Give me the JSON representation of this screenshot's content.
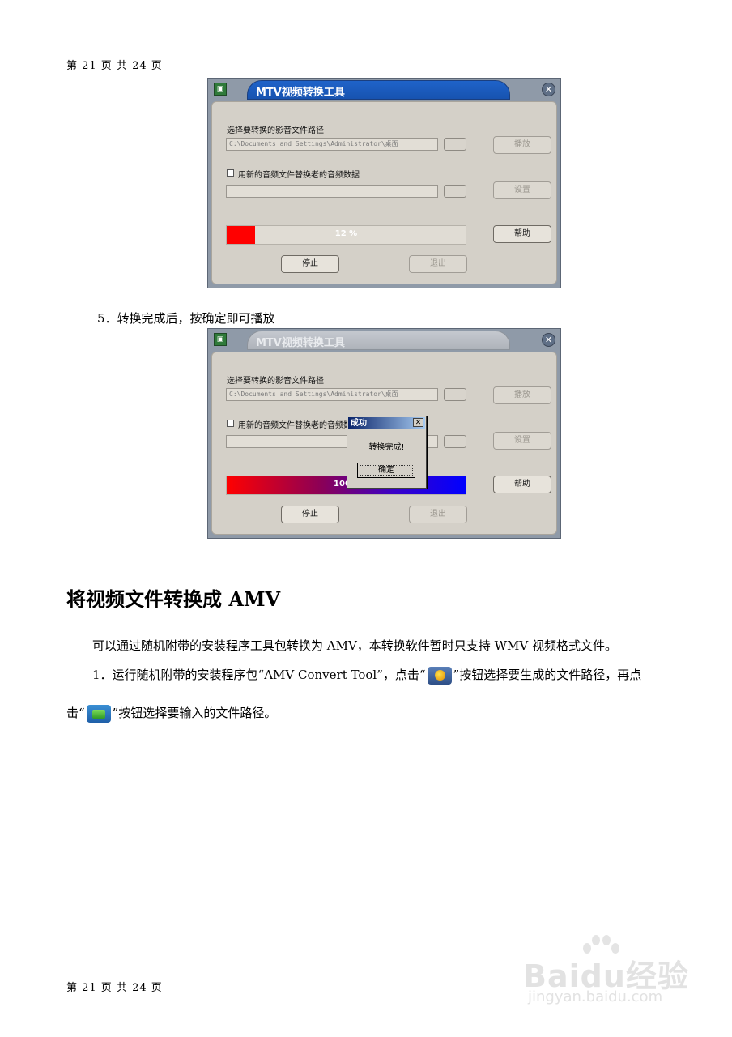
{
  "page": {
    "number_label": "第 21 页 共 24 页"
  },
  "window1": {
    "title": "MTV视频转换工具",
    "close_glyph": "✕",
    "source_label": "选择要转换的影音文件路径",
    "source_path": "C:\\Documents and Settings\\Administrator\\桌面",
    "replace_audio_label": "用新的音频文件替换老的音频数据",
    "replace_audio_checked": false,
    "audio_path": "",
    "play_button": "播放",
    "settings_button": "设置",
    "help_button": "帮助",
    "stop_button": "停止",
    "exit_button": "退出",
    "progress_text": "12 %",
    "progress": 0.12,
    "progress_color": "#ff0000"
  },
  "step5": "5．转换完成后，按确定即可播放",
  "window2": {
    "title": "MTV视频转换工具",
    "close_glyph": "✕",
    "source_label": "选择要转换的影音文件路径",
    "source_path": "C:\\Documents and Settings\\Administrator\\桌面",
    "replace_audio_label": "用新的音频文件替换老的音频数据",
    "replace_audio_checked": false,
    "audio_path": "",
    "play_button": "播放",
    "settings_button": "设置",
    "help_button": "帮助",
    "stop_button": "停止",
    "exit_button": "退出",
    "progress_text": "100%",
    "progress": 1.0,
    "dialog": {
      "title": "成功",
      "message": "转换完成!",
      "ok_button": "确定",
      "close_glyph": "✕"
    }
  },
  "section": {
    "heading": "将视频文件转换成 AMV",
    "intro": "可以通过随机附带的安装程序工具包转换为 AMV，本转换软件暂时只支持 WMV 视频格式文件。",
    "step1_part1": "1．运行随机附带的安装程序包“AMV Convert Tool”，点击“",
    "step1_part2": "”按钮选择要生成的文件路径，再点",
    "step1_part3": "击“",
    "step1_part4": "”按钮选择要输入的文件路径。"
  },
  "watermark": {
    "logo": "Baidu经验",
    "url": "jingyan.baidu.com"
  },
  "icons": {
    "app_icon": "app-icon",
    "generate_path_icon": "generate-path-icon",
    "open_file_icon": "open-file-icon"
  }
}
